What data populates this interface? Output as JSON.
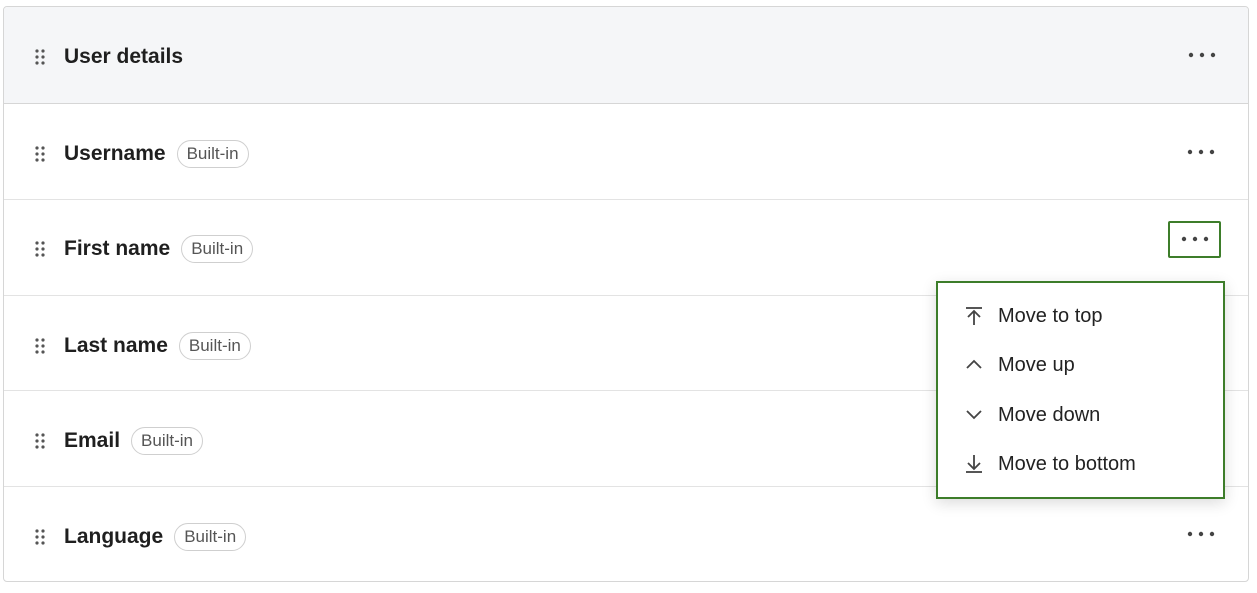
{
  "section": {
    "title": "User details",
    "handle_icon": "drag-handle-icon",
    "more_icon": "more-horizontal-icon"
  },
  "fields": [
    {
      "name": "Username",
      "badge": "Built-in"
    },
    {
      "name": "First name",
      "badge": "Built-in"
    },
    {
      "name": "Last name",
      "badge": "Built-in"
    },
    {
      "name": "Email",
      "badge": "Built-in"
    },
    {
      "name": "Language",
      "badge": "Built-in"
    }
  ],
  "menu": {
    "items": [
      {
        "label": "Move to top",
        "icon": "arrow-up-to-line-icon"
      },
      {
        "label": "Move up",
        "icon": "chevron-up-icon"
      },
      {
        "label": "Move down",
        "icon": "chevron-down-icon"
      },
      {
        "label": "Move to bottom",
        "icon": "arrow-down-to-line-icon"
      }
    ]
  },
  "colors": {
    "header_bg": "#f5f6f8",
    "focus_outline": "#3d7d2a",
    "border": "#d6d6d6",
    "text": "#1f1f1f"
  }
}
